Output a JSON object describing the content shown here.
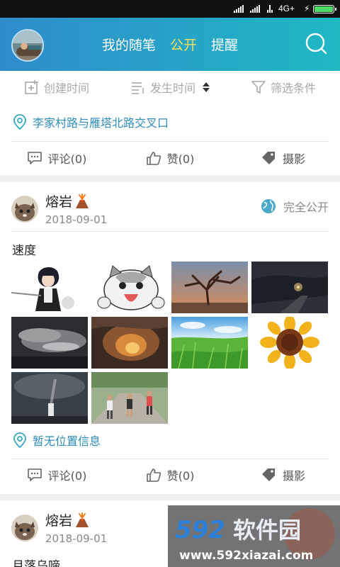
{
  "status_bar": {
    "network": "4G+",
    "battery_color": "#4cd964",
    "battery_level": 0.95
  },
  "header": {
    "tabs": [
      {
        "label": "我的随笔",
        "active": false
      },
      {
        "label": "公开",
        "active": true
      },
      {
        "label": "提醒",
        "active": false
      }
    ],
    "icons": {
      "avatar": "avatar",
      "search": "search-icon"
    },
    "colors": {
      "gradient_start": "#2f8ccc",
      "gradient_end": "#1fb8c3",
      "active_tab": "#f6e25c"
    }
  },
  "filters": [
    {
      "label": "创建时间",
      "icon": "add-square-icon"
    },
    {
      "label": "发生时间",
      "icon": "list-icon",
      "sort": "sort-icon"
    },
    {
      "label": "筛选条件",
      "icon": "filter-icon"
    }
  ],
  "posts": [
    {
      "location": "李家村路与雁塔北路交叉口",
      "actions": {
        "comment": "评论(0)",
        "like": "赞(0)",
        "photo": "摄影"
      }
    },
    {
      "author": "熔岩",
      "author_emoji": "volcano-icon",
      "date": "2018-09-01",
      "privacy": "完全公开",
      "title": "速度",
      "photos": [
        "anime-swordsman",
        "cartoon-cat",
        "bare-tree-sunset",
        "night-road",
        "storm-clouds",
        "fire-clouds",
        "green-grass",
        "sunflower",
        "lighthouse-storm",
        "runners-road"
      ],
      "location": "暂无位置信息",
      "actions": {
        "comment": "评论(0)",
        "like": "赞(0)",
        "photo": "摄影"
      }
    },
    {
      "author": "熔岩",
      "author_emoji": "volcano-icon",
      "date": "2018-09-01",
      "title": "月落乌啼"
    }
  ],
  "watermark": {
    "logo": "592软件园",
    "url": "www.592xiazai.com"
  }
}
